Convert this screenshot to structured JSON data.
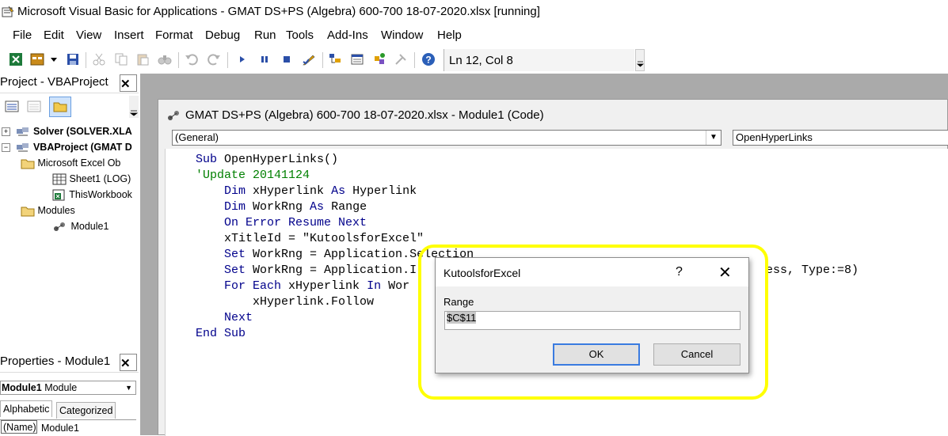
{
  "window": {
    "title": "Microsoft Visual Basic for Applications - GMAT DS+PS (Algebra) 600-700 18-07-2020.xlsx [running]"
  },
  "menu": {
    "items": [
      "File",
      "Edit",
      "View",
      "Insert",
      "Format",
      "Debug",
      "Run",
      "Tools",
      "Add-Ins",
      "Window",
      "Help"
    ]
  },
  "toolbar": {
    "icons": [
      "excel-icon",
      "insert-userform-icon",
      "dropdown-icon",
      "save-icon",
      "cut-icon",
      "copy-icon",
      "paste-icon",
      "find-icon",
      "undo-icon",
      "redo-icon",
      "run-icon",
      "break-icon",
      "reset-icon",
      "design-mode-icon",
      "project-explorer-icon",
      "properties-window-icon",
      "object-browser-icon",
      "toolbox-icon",
      "help-icon"
    ],
    "status": "Ln 12, Col 8"
  },
  "project_pane": {
    "title": "Project - VBAProject",
    "tree": [
      {
        "label": "Solver (SOLVER.XLA",
        "bold": true
      },
      {
        "label": "VBAProject (GMAT D",
        "bold": true
      },
      {
        "label": "Microsoft Excel Ob",
        "bold": false
      },
      {
        "label": "Sheet1 (LOG)",
        "bold": false
      },
      {
        "label": "ThisWorkbook",
        "bold": false
      },
      {
        "label": "Modules",
        "bold": false
      },
      {
        "label": "Module1",
        "bold": false
      }
    ]
  },
  "properties_pane": {
    "title": "Properties - Module1",
    "object_name": "Module1",
    "object_type": "Module",
    "tabs": [
      "Alphabetic",
      "Categorized"
    ],
    "row_name": "(Name)",
    "row_value": "Module1"
  },
  "code_window": {
    "title": "GMAT DS+PS (Algebra) 600-700 18-07-2020.xlsx - Module1 (Code)",
    "object_combo": "(General)",
    "proc_combo": "OpenHyperLinks",
    "lines": [
      "Sub OpenHyperLinks()",
      "'Update 20141124",
      "    Dim xHyperlink As Hyperlink",
      "    Dim WorkRng As Range",
      "    On Error Resume Next",
      "    xTitleId = \"KutoolsforExcel\"",
      "    Set WorkRng = Application.Selection",
      "    Set WorkRng = Application.I",
      "    For Each xHyperlink In Wor",
      "        xHyperlink.Follow",
      "    Next",
      "End Sub"
    ],
    "line8_tail": "ess, Type:=8)"
  },
  "dialog": {
    "title": "KutoolsforExcel",
    "help": "?",
    "close": "✕",
    "label": "Range",
    "value": "$C$11",
    "ok": "OK",
    "cancel": "Cancel"
  },
  "colors": {
    "keyword": "#00008b",
    "comment": "#008000",
    "highlight": "#ffff00",
    "mdi_background": "#aaaaaa"
  }
}
